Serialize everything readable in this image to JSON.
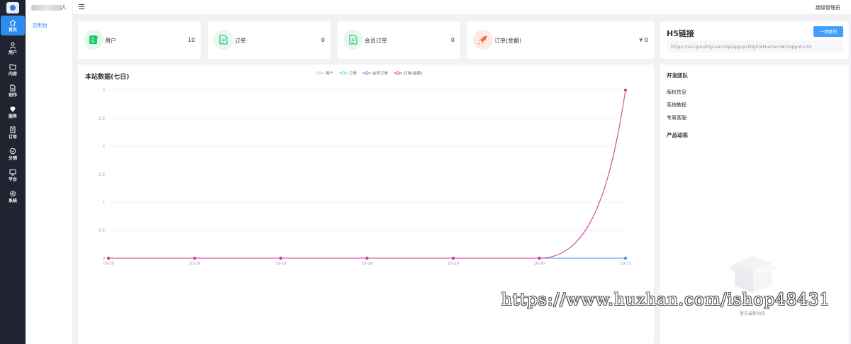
{
  "rail": {
    "items": [
      {
        "label": "首页",
        "icon": "home-icon"
      },
      {
        "label": "用户",
        "icon": "user-icon"
      },
      {
        "label": "内容",
        "icon": "folder-icon"
      },
      {
        "label": "创作",
        "icon": "file-icon"
      },
      {
        "label": "服务",
        "icon": "diamond-icon"
      },
      {
        "label": "订单",
        "icon": "order-icon"
      },
      {
        "label": "分销",
        "icon": "share-icon"
      },
      {
        "label": "平台",
        "icon": "monitor-icon"
      },
      {
        "label": "系统",
        "icon": "gear-icon"
      }
    ]
  },
  "subnav": {
    "name_suffix": "人",
    "item": "控制台"
  },
  "header": {
    "user": "超级管理员"
  },
  "stats": [
    {
      "name": "用户",
      "value": "10",
      "icon": "user-edit-icon",
      "color": "#18c96b",
      "bg": "#e6f8ee"
    },
    {
      "name": "订单",
      "value": "0",
      "icon": "order-doc-icon",
      "color": "#2ec47a",
      "bg": "#e8f7ef"
    },
    {
      "name": "会员订单",
      "value": "0",
      "icon": "member-order-icon",
      "color": "#2ec47a",
      "bg": "#e8f7ef"
    },
    {
      "name": "订单(金额)",
      "value": "¥ 0",
      "icon": "rocket-icon",
      "color": "#f1683a",
      "bg": "#fdeae3"
    }
  ],
  "chart_data": {
    "type": "line",
    "title": "本站数据(七日)",
    "categories": [
      "10-25",
      "10-26",
      "10-27",
      "10-28",
      "10-29",
      "10-30",
      "10-31"
    ],
    "series": [
      {
        "name": "用户",
        "values": [
          0,
          0,
          0,
          0,
          0,
          0,
          0
        ],
        "color": "#91e8b3"
      },
      {
        "name": "订单",
        "values": [
          0,
          0,
          0,
          0,
          0,
          0,
          0
        ],
        "color": "#5bd2e8"
      },
      {
        "name": "会员订单",
        "values": [
          0,
          0,
          0,
          0,
          0,
          0,
          0
        ],
        "color": "#4f8fdc"
      },
      {
        "name": "订单(金额)",
        "values": [
          0,
          0,
          0,
          0,
          0,
          0,
          3
        ],
        "color": "#d23a9a"
      }
    ],
    "ylim": [
      0,
      3
    ],
    "yticks": [
      "0",
      "0.5",
      "1",
      "1.5",
      "2",
      "2.5",
      "3"
    ],
    "legend": "top-center",
    "grid": true,
    "smooth": true
  },
  "h5": {
    "title": "H5链接",
    "button": "一键复制",
    "url": "https://szr.guozhiyuan.top/app/ycDigitalHuman/#/?appid=20"
  },
  "team": {
    "title": "开发团队",
    "links": [
      "版权信息",
      "系统教程",
      "专属客服"
    ],
    "news_title": "产品动态",
    "empty": "暂无最新动态"
  },
  "watermark": "https://www.huzhan.com/ishop48431"
}
